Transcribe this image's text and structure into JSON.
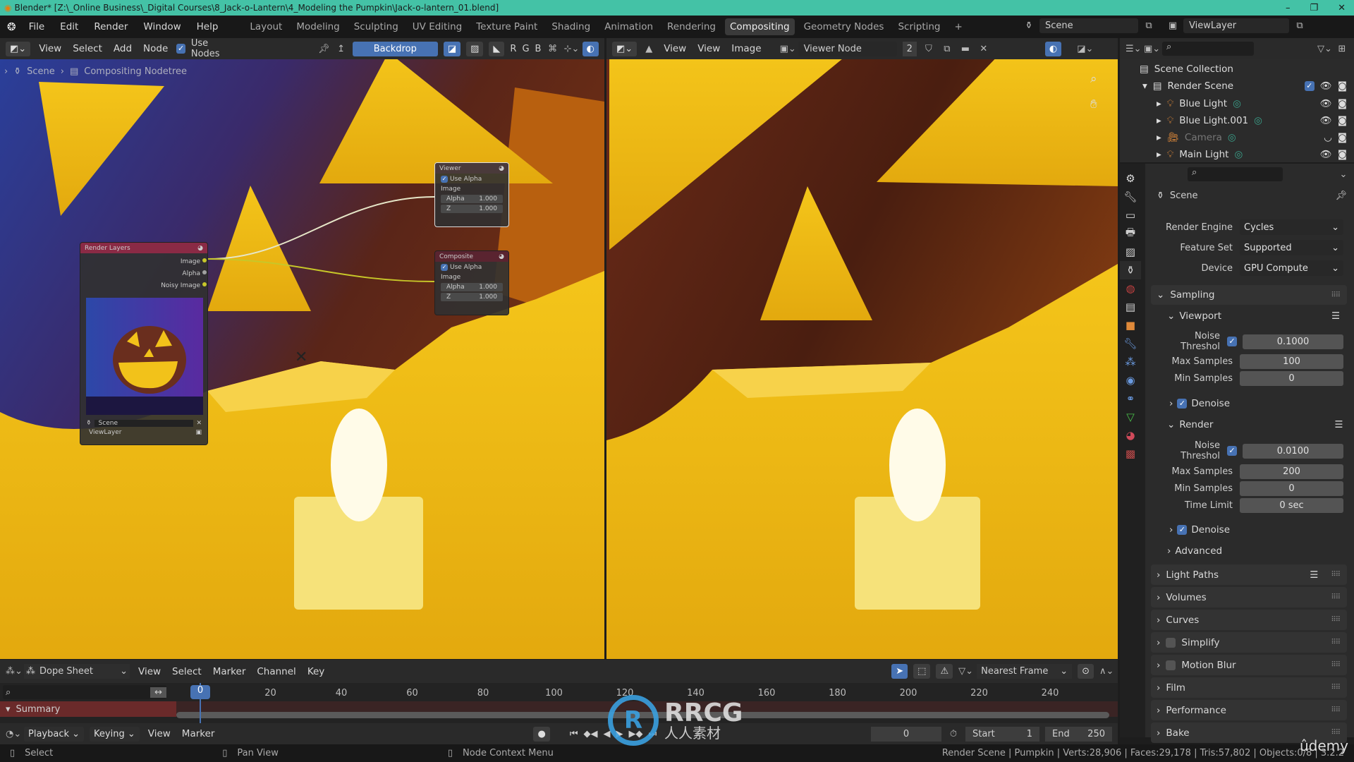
{
  "window": {
    "title": "Blender* [Z:\\_Online Business\\_Digital Courses\\8_Jack-o-Lantern\\4_Modeling the Pumpkin\\Jack-o-lantern_01.blend]",
    "controls": [
      "–",
      "❐",
      "✕"
    ]
  },
  "menu": [
    "File",
    "Edit",
    "Render",
    "Window",
    "Help"
  ],
  "workspaces": [
    "Layout",
    "Modeling",
    "Sculpting",
    "UV Editing",
    "Texture Paint",
    "Shading",
    "Animation",
    "Rendering",
    "Compositing",
    "Geometry Nodes",
    "Scripting"
  ],
  "active_workspace": "Compositing",
  "add_workspace": "+",
  "scene_selector": {
    "value": "Scene"
  },
  "viewlayer_selector": {
    "value": "ViewLayer"
  },
  "node_editor": {
    "menu": [
      "View",
      "Select",
      "Add",
      "Node"
    ],
    "use_nodes": "Use Nodes",
    "backdrop": "Backdrop",
    "channels": [
      "R",
      "G",
      "B"
    ],
    "breadcrumb": [
      "Scene",
      "Compositing Nodetree"
    ],
    "nodes": {
      "render_layers": {
        "title": "Render Layers",
        "outputs": [
          "Image",
          "Alpha",
          "Noisy Image"
        ],
        "scene": "Scene",
        "view_layer": "ViewLayer"
      },
      "viewer": {
        "title": "Viewer",
        "use_alpha": "Use Alpha",
        "input": "Image",
        "fields": [
          {
            "label": "Alpha",
            "value": "1.000"
          },
          {
            "label": "Z",
            "value": "1.000"
          }
        ]
      },
      "composite": {
        "title": "Composite",
        "use_alpha": "Use Alpha",
        "input": "Image",
        "fields": [
          {
            "label": "Alpha",
            "value": "1.000"
          },
          {
            "label": "Z",
            "value": "1.000"
          }
        ]
      }
    }
  },
  "image_editor": {
    "view_menu": "View",
    "menu": [
      "View",
      "Image"
    ],
    "image_name": "Viewer Node",
    "users": "2"
  },
  "outliner": {
    "root": "Scene Collection",
    "collection": "Render Scene",
    "items": [
      {
        "name": "Blue Light",
        "dim": false
      },
      {
        "name": "Blue Light.001",
        "dim": false
      },
      {
        "name": "Camera",
        "dim": true
      },
      {
        "name": "Main Light",
        "dim": false
      }
    ]
  },
  "properties": {
    "context": "Scene",
    "render_engine": {
      "label": "Render Engine",
      "value": "Cycles"
    },
    "feature_set": {
      "label": "Feature Set",
      "value": "Supported"
    },
    "device": {
      "label": "Device",
      "value": "GPU Compute"
    },
    "sampling": "Sampling",
    "viewport": {
      "title": "Viewport",
      "noise_threshold": {
        "label": "Noise Threshol",
        "value": "0.1000",
        "enabled": true
      },
      "max_samples": {
        "label": "Max Samples",
        "value": "100"
      },
      "min_samples": {
        "label": "Min Samples",
        "value": "0"
      },
      "denoise": "Denoise"
    },
    "render": {
      "title": "Render",
      "noise_threshold": {
        "label": "Noise Threshol",
        "value": "0.0100",
        "enabled": true
      },
      "max_samples": {
        "label": "Max Samples",
        "value": "200"
      },
      "min_samples": {
        "label": "Min Samples",
        "value": "0"
      },
      "time_limit": {
        "label": "Time Limit",
        "value": "0 sec"
      },
      "denoise": "Denoise"
    },
    "advanced": "Advanced",
    "panels": [
      {
        "label": "Light Paths",
        "checkbox": false
      },
      {
        "label": "Volumes",
        "checkbox": false
      },
      {
        "label": "Curves",
        "checkbox": false
      },
      {
        "label": "Simplify",
        "checkbox": true
      },
      {
        "label": "Motion Blur",
        "checkbox": true
      },
      {
        "label": "Film",
        "checkbox": false
      },
      {
        "label": "Performance",
        "checkbox": false
      },
      {
        "label": "Bake",
        "checkbox": false
      }
    ]
  },
  "dopesheet": {
    "mode": "Dope Sheet",
    "menu": [
      "View",
      "Select",
      "Marker",
      "Channel",
      "Key"
    ],
    "snap": "Nearest Frame",
    "current_frame_badge": "0",
    "ticks": [
      "20",
      "40",
      "60",
      "80",
      "100",
      "120",
      "140",
      "160",
      "180",
      "200",
      "220",
      "240"
    ],
    "summary": "Summary"
  },
  "timeline": {
    "menu": [
      "Playback",
      "Keying",
      "View",
      "Marker"
    ],
    "current_frame": "0",
    "start_label": "Start",
    "start": "1",
    "end_label": "End",
    "end": "250"
  },
  "statusbar": {
    "hints": [
      "Select",
      "Pan View",
      "Node Context Menu"
    ],
    "info": "Render Scene | Pumpkin | Verts:28,906 | Faces:29,178 | Tris:57,802 | Objects:0/8 | 3.2.2"
  },
  "watermark": {
    "text": "RRCG",
    "sub": "人人素材",
    "corner": "ûdemy"
  },
  "colors": {
    "accent": "#4772b3",
    "titlebar": "#44c2a6",
    "socket": "#c7c729",
    "render_layers_header": "#8a2a45",
    "composite_header": "#5a2430",
    "summary": "#6a2a2a"
  }
}
